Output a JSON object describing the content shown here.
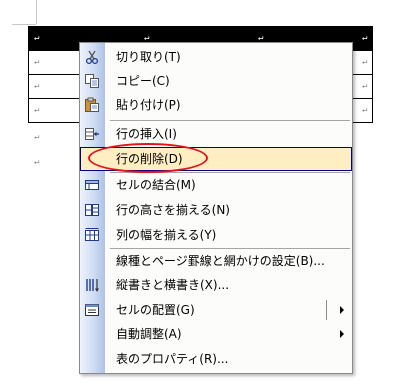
{
  "document": {
    "paragraph_mark": "↵"
  },
  "context_menu": {
    "items": [
      {
        "id": "cut",
        "label": "切り取り(T)",
        "icon": "scissors-icon"
      },
      {
        "id": "copy",
        "label": "コピー(C)",
        "icon": "copy-icon"
      },
      {
        "id": "paste",
        "label": "貼り付け(P)",
        "icon": "paste-icon"
      },
      {
        "id": "insert",
        "label": "行の挿入(I)",
        "icon": "insert-rows-icon"
      },
      {
        "id": "delete",
        "label": "行の削除(D)",
        "icon": "delete-rows-icon",
        "highlighted": true
      },
      {
        "id": "merge",
        "label": "セルの結合(M)",
        "icon": "merge-cells-icon"
      },
      {
        "id": "distribute-rows",
        "label": "行の高さを揃える(N)",
        "icon": "distribute-rows-icon"
      },
      {
        "id": "distribute-cols",
        "label": "列の幅を揃える(Y)",
        "icon": "distribute-columns-icon"
      },
      {
        "id": "borders",
        "label": "線種とページ罫線と網かけの設定(B)...",
        "icon": ""
      },
      {
        "id": "text-direction",
        "label": "縦書きと横書き(X)...",
        "icon": "text-direction-icon"
      },
      {
        "id": "cell-alignment",
        "label": "セルの配置(G)",
        "icon": "cell-alignment-icon",
        "submenu": true
      },
      {
        "id": "autofit",
        "label": "自動調整(A)",
        "icon": "",
        "submenu": true
      },
      {
        "id": "properties",
        "label": "表のプロパティ(R)...",
        "icon": ""
      }
    ]
  },
  "colors": {
    "highlight_bg": "#ffeec2",
    "highlight_border": "#000080",
    "annotation_ellipse": "#e3131d"
  }
}
